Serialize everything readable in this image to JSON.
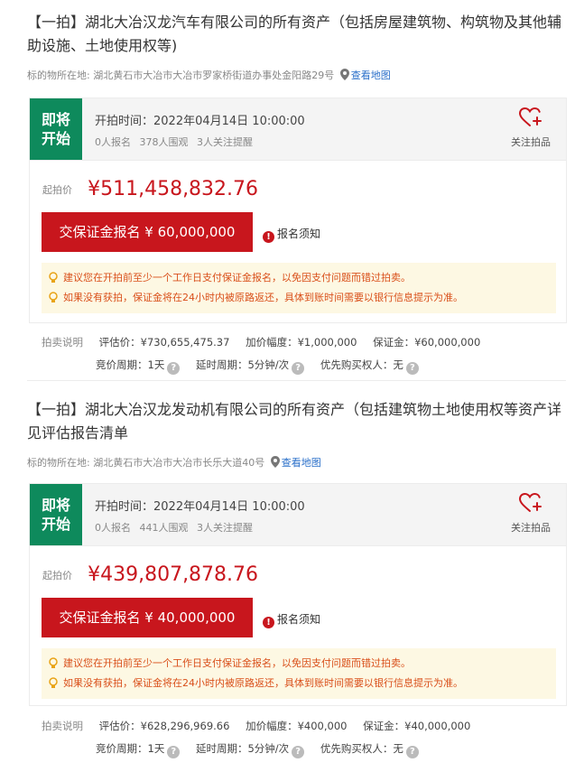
{
  "lots": [
    {
      "title": "【一拍】湖北大冶汉龙汽车有限公司的所有资产（包括房屋建筑物、构筑物及其他辅助设施、土地使用权等)",
      "location_label": "标的物所在地:",
      "location": "湖北黄石市大冶市大冶市罗家桥街道办事处金阳路29号",
      "map_link": "查看地图",
      "status_line1": "即将",
      "status_line2": "开始",
      "start_time": "开拍时间：2022年04月14日 10:00:00",
      "signups": "0人报名",
      "views": "378人围观",
      "followers": "3人关注提醒",
      "follow_label": "关注拍品",
      "start_price_label": "起拍价",
      "start_price": "¥511,458,832.76",
      "deposit_button": "交保证金报名 ¥ 60,000,000",
      "notice_link": "报名须知",
      "tips": [
        "建议您在开拍前至少一个工作日支付保证金报名，以免因支付问题而错过拍卖。",
        "如果没有获拍，保证金将在24小时内被原路返还，具体到账时间需要以银行信息提示为准。"
      ],
      "info_label": "拍卖说明",
      "appraisal": "评估价：¥730,655,475.37",
      "increment": "加价幅度：¥1,000,000",
      "deposit": "保证金：¥60,000,000",
      "bid_period": "竞价周期：1天",
      "extension": "延时周期：5分钟/次",
      "priority": "优先购买权人：无"
    },
    {
      "title": "【一拍】湖北大冶汉龙发动机有限公司的所有资产（包括建筑物土地使用权等资产详见评估报告清单",
      "location_label": "标的物所在地:",
      "location": "湖北黄石市大冶市大冶市长乐大道40号",
      "map_link": "查看地图",
      "status_line1": "即将",
      "status_line2": "开始",
      "start_time": "开拍时间：2022年04月14日 10:00:00",
      "signups": "0人报名",
      "views": "441人围观",
      "followers": "3人关注提醒",
      "follow_label": "关注拍品",
      "start_price_label": "起拍价",
      "start_price": "¥439,807,878.76",
      "deposit_button": "交保证金报名 ¥ 40,000,000",
      "notice_link": "报名须知",
      "tips": [
        "建议您在开拍前至少一个工作日支付保证金报名，以免因支付问题而错过拍卖。",
        "如果没有获拍，保证金将在24小时内被原路返还，具体到账时间需要以银行信息提示为准。"
      ],
      "info_label": "拍卖说明",
      "appraisal": "评估价：¥628,296,969.66",
      "increment": "加价幅度：¥400,000",
      "deposit": "保证金：¥40,000,000",
      "bid_period": "竞价周期：1天",
      "extension": "延时周期：5分钟/次",
      "priority": "优先购买权人：无"
    }
  ],
  "colors": {
    "status_green": "#0e8a5c",
    "accent_red": "#c8161d",
    "tip_text": "#d94f1a",
    "tip_bg": "#fdf8e3",
    "link_blue": "#2a6fc9"
  },
  "icons": [
    "location-pin-icon",
    "heart-plus-icon",
    "warning-icon",
    "lightbulb-icon",
    "question-icon"
  ]
}
